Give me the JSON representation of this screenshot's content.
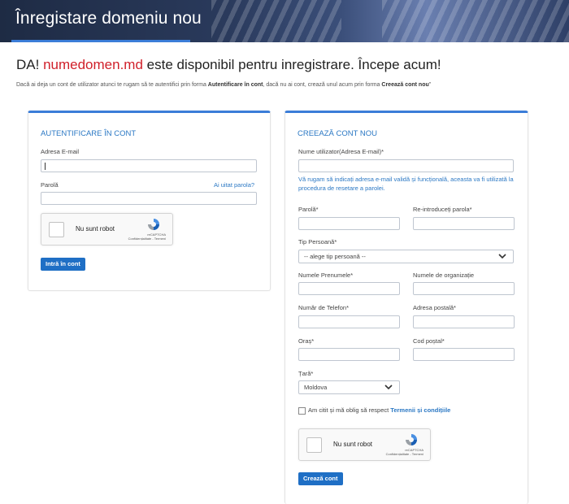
{
  "banner": {
    "title": "Înregistare domeniu nou"
  },
  "headline": {
    "prefix": "DA!",
    "domain": "numedomen.md",
    "suffix": "este disponibil pentru inregistrare. Începe acum!"
  },
  "intro": {
    "part1": "Dacă ai deja un cont de utilizator atunci te rugam să te autentifici prin forma ",
    "bold1": "Autentificare în cont",
    "part2": ", dacă nu ai cont, crează unul acum prin forma ",
    "bold2": "Creează cont nou",
    "part3": "\""
  },
  "login": {
    "title": "AUTENTIFICARE ÎN CONT",
    "email_label": "Adresa E-mail",
    "email_value": "",
    "password_label": "Parolă",
    "forgot_link": "Ai uitat parola?",
    "recaptcha_label": "Nu sunt robot",
    "recaptcha_brand": "reCAPTCHA",
    "recaptcha_links": "Confidențialitate - Termeni",
    "submit": "Intră în cont"
  },
  "register": {
    "title": "CREEAZĂ CONT NOU",
    "username_label": "Nume utilizator(Adresa E-mail)*",
    "username_note": "Vă rugam să indicați adresa e-mail validă și funcțională, aceasta va fi utilizată la procedura de resetare a parolei.",
    "password_label": "Parolă*",
    "password_repeat_label": "Re-introduceți parola*",
    "person_type_label": "Tip Persoană*",
    "person_type_value": "-- alege tip persoană --",
    "name_label": "Numele Prenumele*",
    "org_label": "Numele de organizație",
    "phone_label": "Număr de Telefon*",
    "address_label": "Adresa postală*",
    "city_label": "Oraș*",
    "postal_label": "Cod poștal*",
    "country_label": "Țară*",
    "country_value": "Moldova",
    "terms_prefix": "Am citit și mă oblig să respect",
    "terms_link": "Termenii și condițiile",
    "recaptcha_label": "Nu sunt robot",
    "recaptcha_brand": "reCAPTCHA",
    "recaptcha_links": "Confidențialitate - Termeni",
    "submit": "Crează cont"
  },
  "colors": {
    "accent": "#3b7dd8",
    "domain": "#d0202a",
    "button": "#1f6fc5"
  }
}
